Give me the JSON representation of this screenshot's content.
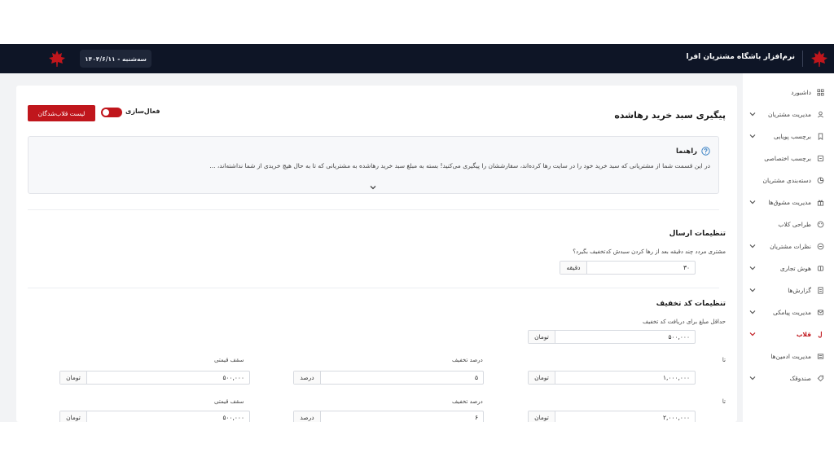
{
  "header": {
    "brand_title": "نرم‌افزار باشگاه مشتریان افرا",
    "date": "سه‌شنبه - ۱۴۰۴/۶/۱۱",
    "brand_color": "#c0161c",
    "bar_color": "#0e1526"
  },
  "sidebar": {
    "items": [
      {
        "label": "داشبورد",
        "icon": "grid-icon"
      },
      {
        "label": "مدیریت مشتریان",
        "icon": "users-icon"
      },
      {
        "label": "برچسب پویایی",
        "icon": "bookmark-icon"
      },
      {
        "label": "برچسب اختصاصی",
        "icon": "tag-icon"
      },
      {
        "label": "دسته‌بندی مشتریان",
        "icon": "pie-icon"
      },
      {
        "label": "مدیریت مشوق‌ها",
        "icon": "gift-icon"
      },
      {
        "label": "طراحی کلاب",
        "icon": "palette-icon"
      },
      {
        "label": "نظرات مشتریان",
        "icon": "chat-icon"
      },
      {
        "label": "هوش تجاری",
        "icon": "brain-icon"
      },
      {
        "label": "گزارش‌ها",
        "icon": "report-icon"
      },
      {
        "label": "مدیریت پیامکی",
        "icon": "sms-icon"
      },
      {
        "label": "قلاب",
        "icon": "hook-icon"
      },
      {
        "label": "مدیریت ادمین‌ها",
        "icon": "admin-icon"
      },
      {
        "label": "صندوقک",
        "icon": "box-icon"
      }
    ]
  },
  "page": {
    "title": "پیگیری سبد خرید رهاشده",
    "toggle_label": "فعال‌سازی",
    "hooked_list_button": "لیست قلاب‌شدگان"
  },
  "guide": {
    "title": "راهنما",
    "text": "در این قسمت شما از مشتریانی که سبد خرید خود را در سایت رها کرده‌اند، سفارششان را پیگیری می‌کنید! بسته به مبلغ سبد خرید رهاشده به مشتریانی که تا به حال هیچ خریدی از شما نداشته‌اند، ..."
  },
  "send_settings": {
    "title": "تنظیمات ارسال",
    "question": "مشتری مردد چند دقیقه بعد از رها کردن سبدش کدتخفیف بگیرد؟",
    "minutes_value": "۳۰",
    "minutes_unit": "دقیقه"
  },
  "discount_settings": {
    "title": "تنظیمات کد تخفیف",
    "min_amount_label": "حداقل مبلغ برای دریافت کد تخفیف",
    "min_amount_value": "۵۰۰,۰۰۰",
    "currency": "تومان",
    "to_label": "تا",
    "percent_label": "درصد تخفیف",
    "percent_unit": "درصد",
    "cap_label": "سقف قیمتی",
    "rows": [
      {
        "to": "۱,۰۰۰,۰۰۰",
        "percent": "۵",
        "cap": "۵۰۰,۰۰۰"
      },
      {
        "to": "۲,۰۰۰,۰۰۰",
        "percent": "۶",
        "cap": "۵۰۰,۰۰۰"
      }
    ]
  }
}
